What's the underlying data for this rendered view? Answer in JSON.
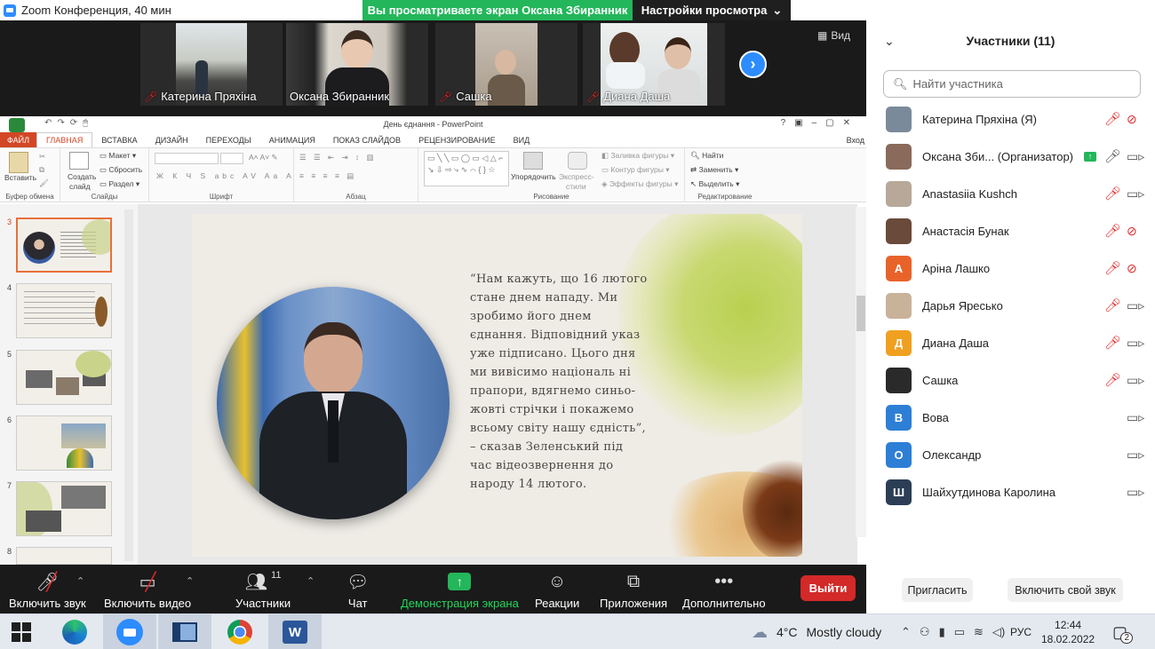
{
  "window": {
    "title": "Zoom Конференция, 40 мин"
  },
  "banner": {
    "sharing": "Вы просматриваете экран Оксана Збиранник",
    "view_options": "Настройки просмотра"
  },
  "strip": {
    "tiles": [
      {
        "name": "Катерина Пряхіна"
      },
      {
        "name": "Оксана Збиранник"
      },
      {
        "name": "Сашка"
      },
      {
        "name": "Диана Даша"
      }
    ],
    "view_label": "Вид"
  },
  "ppt": {
    "title": "День єднання - PowerPoint",
    "signin": "Вход",
    "tabs": [
      "ФАЙЛ",
      "ГЛАВНАЯ",
      "ВСТАВКА",
      "ДИЗАЙН",
      "ПЕРЕХОДЫ",
      "АНИМАЦИЯ",
      "ПОКАЗ СЛАЙДОВ",
      "РЕЦЕНЗИРОВАНИЕ",
      "ВИД"
    ],
    "ribbon": {
      "paste": "Вставить",
      "clipboard": "Буфер обмена",
      "new_slide_1": "Создать",
      "new_slide_2": "слайд",
      "layout": "Макет",
      "reset": "Сбросить",
      "section": "Раздел",
      "slides": "Слайды",
      "font": "Шрифт",
      "paragraph": "Абзац",
      "arrange": "Упорядочить",
      "quick_styles_1": "Экспресс-",
      "quick_styles_2": "стили",
      "fill": "Заливка фигуры",
      "outline": "Контур фигуры",
      "effects": "Эффекты фигуры",
      "drawing": "Рисование",
      "find": "Найти",
      "replace": "Заменить",
      "select": "Выделить",
      "editing": "Редактирование"
    },
    "thumb_numbers": [
      "3",
      "4",
      "5",
      "6",
      "7",
      "8"
    ],
    "quote": "“Нам кажуть, що 16 лютого стане днем нападу. Ми зробимо його днем єднання. Відповідний указ уже підписано. Цього дня ми вивісимо національ ні прапори, вдягнемо синьо-жовті стрічки і покажемо всьому світу нашу єдність”, – сказав Зеленський під час відеозвернення до народу 14 лютого."
  },
  "controls": {
    "unmute": "Включить звук",
    "start_video": "Включить видео",
    "participants": "Участники",
    "participants_count": "11",
    "chat": "Чат",
    "share": "Демонстрация экрана",
    "reactions": "Реакции",
    "apps": "Приложения",
    "more": "Дополнительно",
    "leave": "Выйти"
  },
  "panel": {
    "title": "Участники (11)",
    "search_placeholder": "Найти участника",
    "participants": [
      {
        "name": "Катерина Пряхіна (Я)",
        "initial": "",
        "color": "#7a8a9a",
        "mic": "off",
        "cam": "off"
      },
      {
        "name": "Оксана Зби...  (Организатор)",
        "initial": "",
        "color": "#8a6a5a",
        "mic": "on",
        "cam": "on"
      },
      {
        "name": "Anastasiia Kushch",
        "initial": "",
        "color": "#b8a89a",
        "mic": "off",
        "cam": "on"
      },
      {
        "name": "Анастасія Бунак",
        "initial": "",
        "color": "#6a4a3a",
        "mic": "off",
        "cam": "off"
      },
      {
        "name": "Аріна Лашко",
        "initial": "А",
        "color": "#e8632a",
        "mic": "off",
        "cam": "off"
      },
      {
        "name": "Дарья Яресько",
        "initial": "",
        "color": "#c9b29a",
        "mic": "off",
        "cam": "on"
      },
      {
        "name": "Диана Даша",
        "initial": "Д",
        "color": "#f0a020",
        "mic": "off",
        "cam": "on"
      },
      {
        "name": "Сашка",
        "initial": "",
        "color": "#2a2a2a",
        "mic": "off",
        "cam": "on"
      },
      {
        "name": "Вова",
        "initial": "В",
        "color": "#2d7fd6",
        "mic": "none",
        "cam": "on"
      },
      {
        "name": "Олександр",
        "initial": "О",
        "color": "#2d7fd6",
        "mic": "none",
        "cam": "on"
      },
      {
        "name": "Шайхутдинова Каролина",
        "initial": "Ш",
        "color": "#2b3e55",
        "mic": "none",
        "cam": "on"
      }
    ],
    "invite": "Пригласить",
    "unmute_me": "Включить свой звук"
  },
  "taskbar": {
    "weather_temp": "4°C",
    "weather_text": "Mostly cloudy",
    "lang": "РУС",
    "time": "12:44",
    "date": "18.02.2022",
    "notif_count": "2"
  }
}
